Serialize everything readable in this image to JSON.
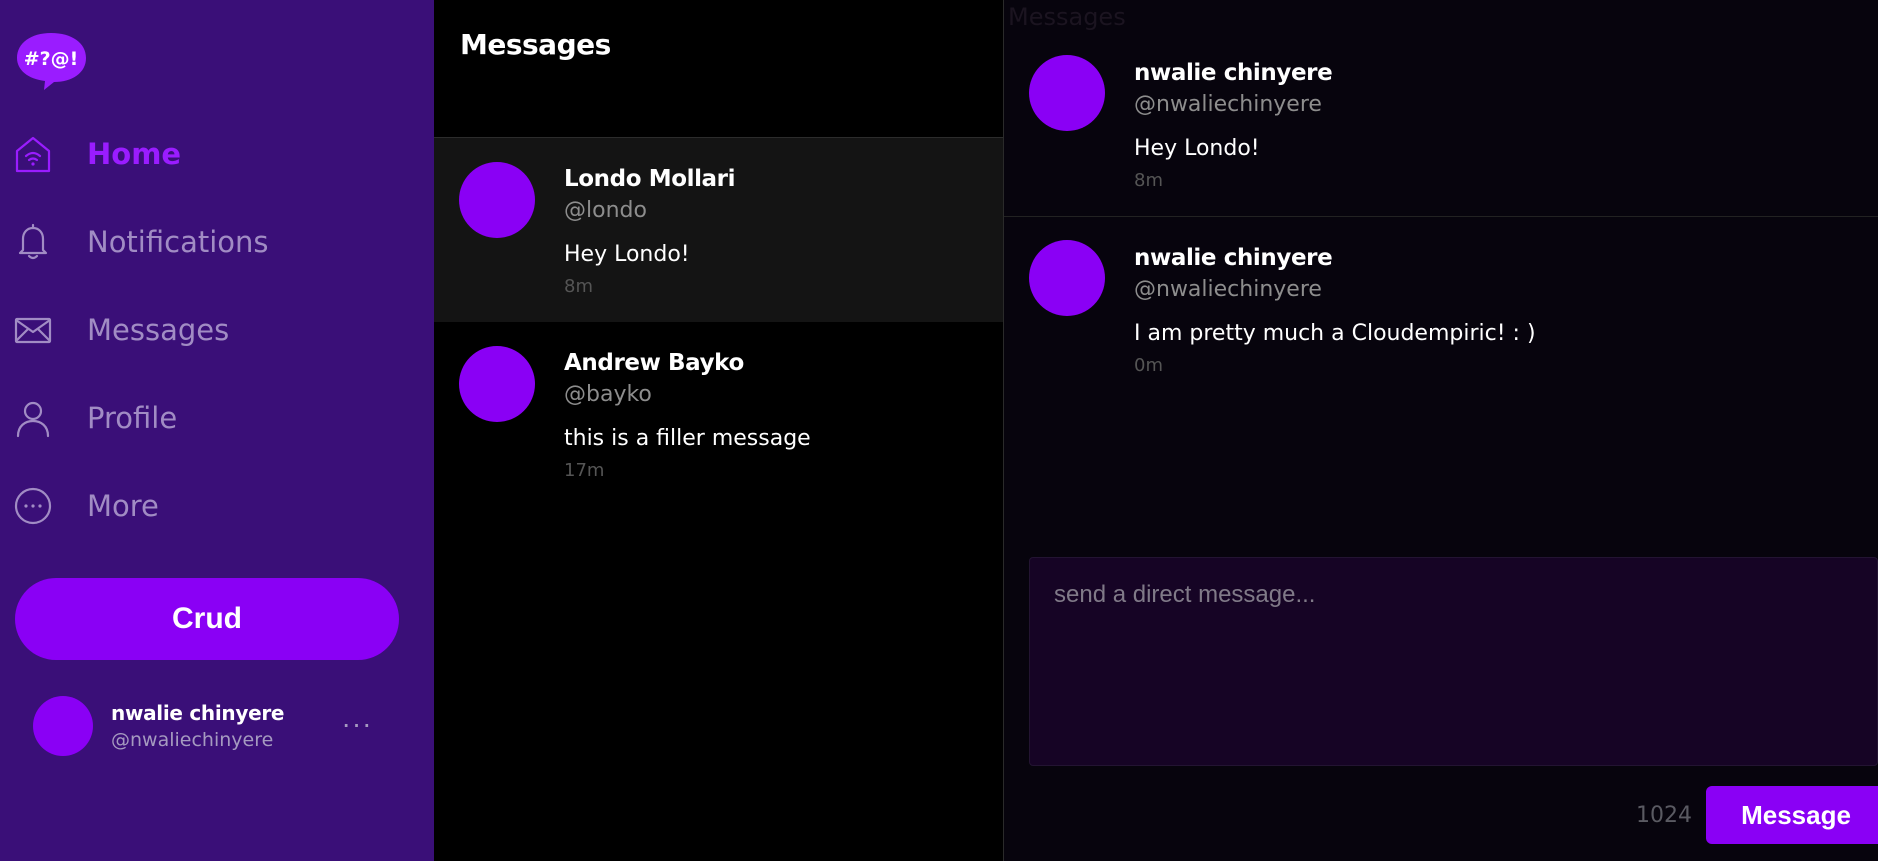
{
  "logo": {
    "text": "#?@!",
    "icon": "speech-bubble-logo-icon"
  },
  "sidebar": {
    "nav": [
      {
        "label": "Home",
        "icon": "home-icon",
        "active": true
      },
      {
        "label": "Notifications",
        "icon": "bell-icon",
        "active": false
      },
      {
        "label": "Messages",
        "icon": "envelope-icon",
        "active": false
      },
      {
        "label": "Profile",
        "icon": "user-icon",
        "active": false
      },
      {
        "label": "More",
        "icon": "more-circle-icon",
        "active": false
      }
    ],
    "crud_label": "Crud",
    "account": {
      "name": "nwalie chinyere",
      "handle": "@nwaliechinyere",
      "menu": "···"
    }
  },
  "conversations": {
    "title": "Messages",
    "items": [
      {
        "name": "Londo Mollari",
        "handle": "@londo",
        "text": "Hey Londo!",
        "time": "8m",
        "selected": true
      },
      {
        "name": "Andrew Bayko",
        "handle": "@bayko",
        "text": "this is a filler message",
        "time": "17m",
        "selected": false
      }
    ]
  },
  "chat": {
    "ghost_title": "Messages",
    "messages": [
      {
        "name": "nwalie chinyere",
        "handle": "@nwaliechinyere",
        "text": "Hey Londo!",
        "time": "8m"
      },
      {
        "name": "nwalie chinyere",
        "handle": "@nwaliechinyere",
        "text": "I am pretty much a Cloudempiric! : )",
        "time": "0m"
      }
    ],
    "input_placeholder": "send a direct message...",
    "char_count": "1024",
    "send_label": "Message"
  },
  "colors": {
    "accent": "#8a00f5",
    "sidebar_bg": "#3a0f78",
    "nav_inactive": "#a18cc4",
    "nav_active": "#9a1cff"
  }
}
